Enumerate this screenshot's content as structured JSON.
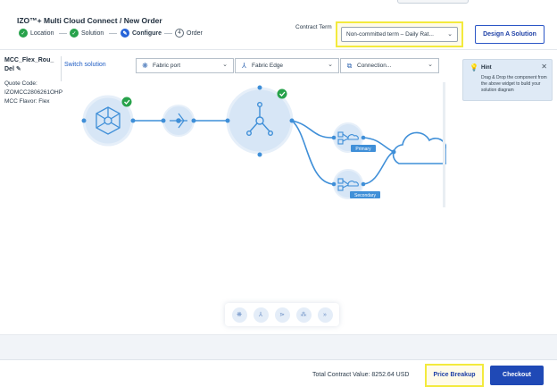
{
  "header": {
    "title": "IZO™+ Multi Cloud Connect / New Order",
    "steps": [
      {
        "label": "Location",
        "state": "done",
        "marker": "✓"
      },
      {
        "label": "Solution",
        "state": "done",
        "marker": "✓"
      },
      {
        "label": "Configure",
        "state": "current",
        "marker": "✎"
      },
      {
        "label": "Order",
        "state": "pending",
        "marker": "4"
      }
    ],
    "contract_term_label": "Contract Term",
    "contract_term_value": "Non-committed term – Daily Rat...",
    "design_button": "Design A Solution"
  },
  "solution": {
    "name": "MCC_Flex_Rou_ Del",
    "quote_label": "Quote Code:",
    "quote_code": "IZOMCC2806261OHP",
    "flavor": "MCC Flavor: Flex",
    "switch_label": "Switch solution"
  },
  "widgets": [
    {
      "label": "Fabric port",
      "icon": "gear-network-icon"
    },
    {
      "label": "Fabric Edge",
      "icon": "edge-node-icon"
    },
    {
      "label": "Connection...",
      "icon": "connection-icon"
    }
  ],
  "hint": {
    "title": "Hint",
    "text": "Drag & Drop the component from the above widget to build your solution diagram"
  },
  "diagram": {
    "primary_label": "Primary",
    "secondary_label": "Secondary"
  },
  "palette": [
    "port-icon",
    "edge-icon",
    "connector-icon",
    "group-icon",
    "link-icon"
  ],
  "footer": {
    "total": "Total Contract Value: 8252.64 USD",
    "price_breakup": "Price Breakup",
    "checkout": "Checkout"
  },
  "colors": {
    "accent": "#1f49b6",
    "success": "#27a24b",
    "highlight": "#f3ea3c",
    "node_fill": "#d7e6f6",
    "line": "#3f8fd8"
  }
}
